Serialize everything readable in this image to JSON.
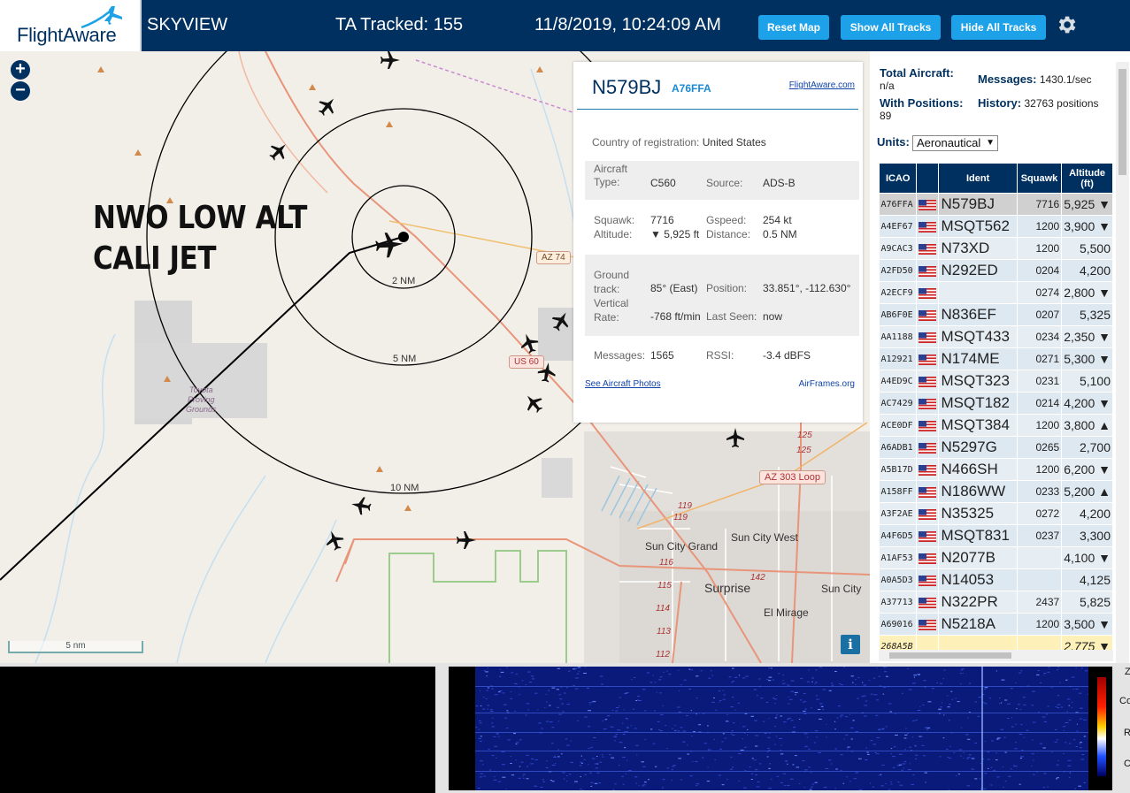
{
  "header": {
    "logo_text": "FlightAware",
    "app_title": "SKYVIEW",
    "ta_tracked": "TA Tracked: 155",
    "clock": "11/8/2019, 10:24:09 AM",
    "buttons": {
      "reset": "Reset Map",
      "show_all": "Show All Tracks",
      "hide_all": "Hide All Tracks"
    },
    "gear_icon": "gear-icon",
    "colors": {
      "bar": "#00305f",
      "button": "#1da1e8"
    }
  },
  "map": {
    "zoom_in": "+",
    "zoom_out": "−",
    "overlay_note": "NWO LOW ALT\nCALI JET",
    "range_labels": [
      "2 NM",
      "5 NM",
      "10 NM"
    ],
    "shields": {
      "az74": "AZ 74",
      "us60": "US 60",
      "loop303": "AZ 303 Loop"
    },
    "place_labels": {
      "proving_grounds": "Toyota\nProving\nGrounds",
      "sun_city_grand": "Sun City Grand",
      "sun_city_west": "Sun City West",
      "surprise": "Surprise",
      "sun_city": "Sun City",
      "el_mirage": "El Mirage"
    },
    "route_numbers": [
      "125",
      "125",
      "119",
      "119",
      "116",
      "115",
      "114",
      "113",
      "112",
      "142"
    ],
    "scale": "5 nm",
    "info_icon": "i"
  },
  "selected": {
    "ident": "N579BJ",
    "icao": "A76FFA",
    "link": "FlightAware.com",
    "country_label": "Country of registration:",
    "country": "United States",
    "type_label": "Aircraft\nType:",
    "type": "C560",
    "source_label": "Source:",
    "source": "ADS-B",
    "squawk_label": "Squawk:",
    "squawk": "7716",
    "altitude_label": "Altitude:",
    "altitude": "▼ 5,925 ft",
    "gspeed_label": "Gspeed:",
    "gspeed": "254 kt",
    "distance_label": "Distance:",
    "distance": "0.5 NM",
    "track_label": "Ground\ntrack:",
    "track": "85° (East)",
    "position_label": "Position:",
    "position": "33.851°, -112.630°",
    "vrate_label": "Vertical\nRate:",
    "vrate": "-768 ft/min",
    "lastseen_label": "Last Seen:",
    "lastseen": "now",
    "messages_label": "Messages:",
    "messages": "1565",
    "rssi_label": "RSSI:",
    "rssi": "-3.4 dBFS",
    "photos_link": "See Aircraft Photos",
    "airframes_link": "AirFrames.org"
  },
  "sidebar": {
    "total_label": "Total Aircraft:",
    "total": "n/a",
    "messages_label": "Messages:",
    "messages": "1430.1/sec",
    "positions_label": "With Positions:",
    "positions": "89",
    "history_label": "History:",
    "history": "32763 positions",
    "units_label": "Units:",
    "units_value": "Aeronautical",
    "columns": [
      "ICAO",
      "",
      "Ident",
      "Squawk",
      "Altitude (ft)"
    ],
    "rows": [
      {
        "icao": "A76FFA",
        "ident": "N579BJ",
        "squawk": "7716",
        "alt": "5,925 ▼"
      },
      {
        "icao": "A4EF67",
        "ident": "MSQT562",
        "squawk": "1200",
        "alt": "3,900 ▼"
      },
      {
        "icao": "A9CAC3",
        "ident": "N73XD",
        "squawk": "1200",
        "alt": "5,500"
      },
      {
        "icao": "A2FD50",
        "ident": "N292ED",
        "squawk": "0204",
        "alt": "4,200"
      },
      {
        "icao": "A2ECF9",
        "ident": "",
        "squawk": "0274",
        "alt": "2,800 ▼"
      },
      {
        "icao": "AB6F0E",
        "ident": "N836EF",
        "squawk": "0207",
        "alt": "5,325"
      },
      {
        "icao": "AA1188",
        "ident": "MSQT433",
        "squawk": "0234",
        "alt": "2,350 ▼"
      },
      {
        "icao": "A12921",
        "ident": "N174ME",
        "squawk": "0271",
        "alt": "5,300 ▼"
      },
      {
        "icao": "A4ED9C",
        "ident": "MSQT323",
        "squawk": "0231",
        "alt": "5,100"
      },
      {
        "icao": "AC7429",
        "ident": "MSQT182",
        "squawk": "0214",
        "alt": "4,200 ▼"
      },
      {
        "icao": "ACE0DF",
        "ident": "MSQT384",
        "squawk": "1200",
        "alt": "3,800 ▲"
      },
      {
        "icao": "A6ADB1",
        "ident": "N5297G",
        "squawk": "0265",
        "alt": "2,700"
      },
      {
        "icao": "A5B17D",
        "ident": "N466SH",
        "squawk": "1200",
        "alt": "6,200 ▼"
      },
      {
        "icao": "A158FF",
        "ident": "N186WW",
        "squawk": "0233",
        "alt": "5,200 ▲"
      },
      {
        "icao": "A3F2AE",
        "ident": "N35325",
        "squawk": "0272",
        "alt": "4,200"
      },
      {
        "icao": "A4F6D5",
        "ident": "MSQT831",
        "squawk": "0237",
        "alt": "3,300"
      },
      {
        "icao": "A1AF53",
        "ident": "N2077B",
        "squawk": "",
        "alt": "4,100 ▼"
      },
      {
        "icao": "A0A5D3",
        "ident": "N14053",
        "squawk": "",
        "alt": "4,125"
      },
      {
        "icao": "A37713",
        "ident": "N322PR",
        "squawk": "2437",
        "alt": "5,825"
      },
      {
        "icao": "A69016",
        "ident": "N5218A",
        "squawk": "1200",
        "alt": "3,500 ▼"
      },
      {
        "icao": "268A5B",
        "ident": "",
        "squawk": "",
        "alt": "2,775 ▼"
      }
    ],
    "flag_icon": "us-flag-icon"
  },
  "bottom": {
    "side_glyphs": [
      "Z",
      "Co",
      "R",
      "C"
    ]
  }
}
